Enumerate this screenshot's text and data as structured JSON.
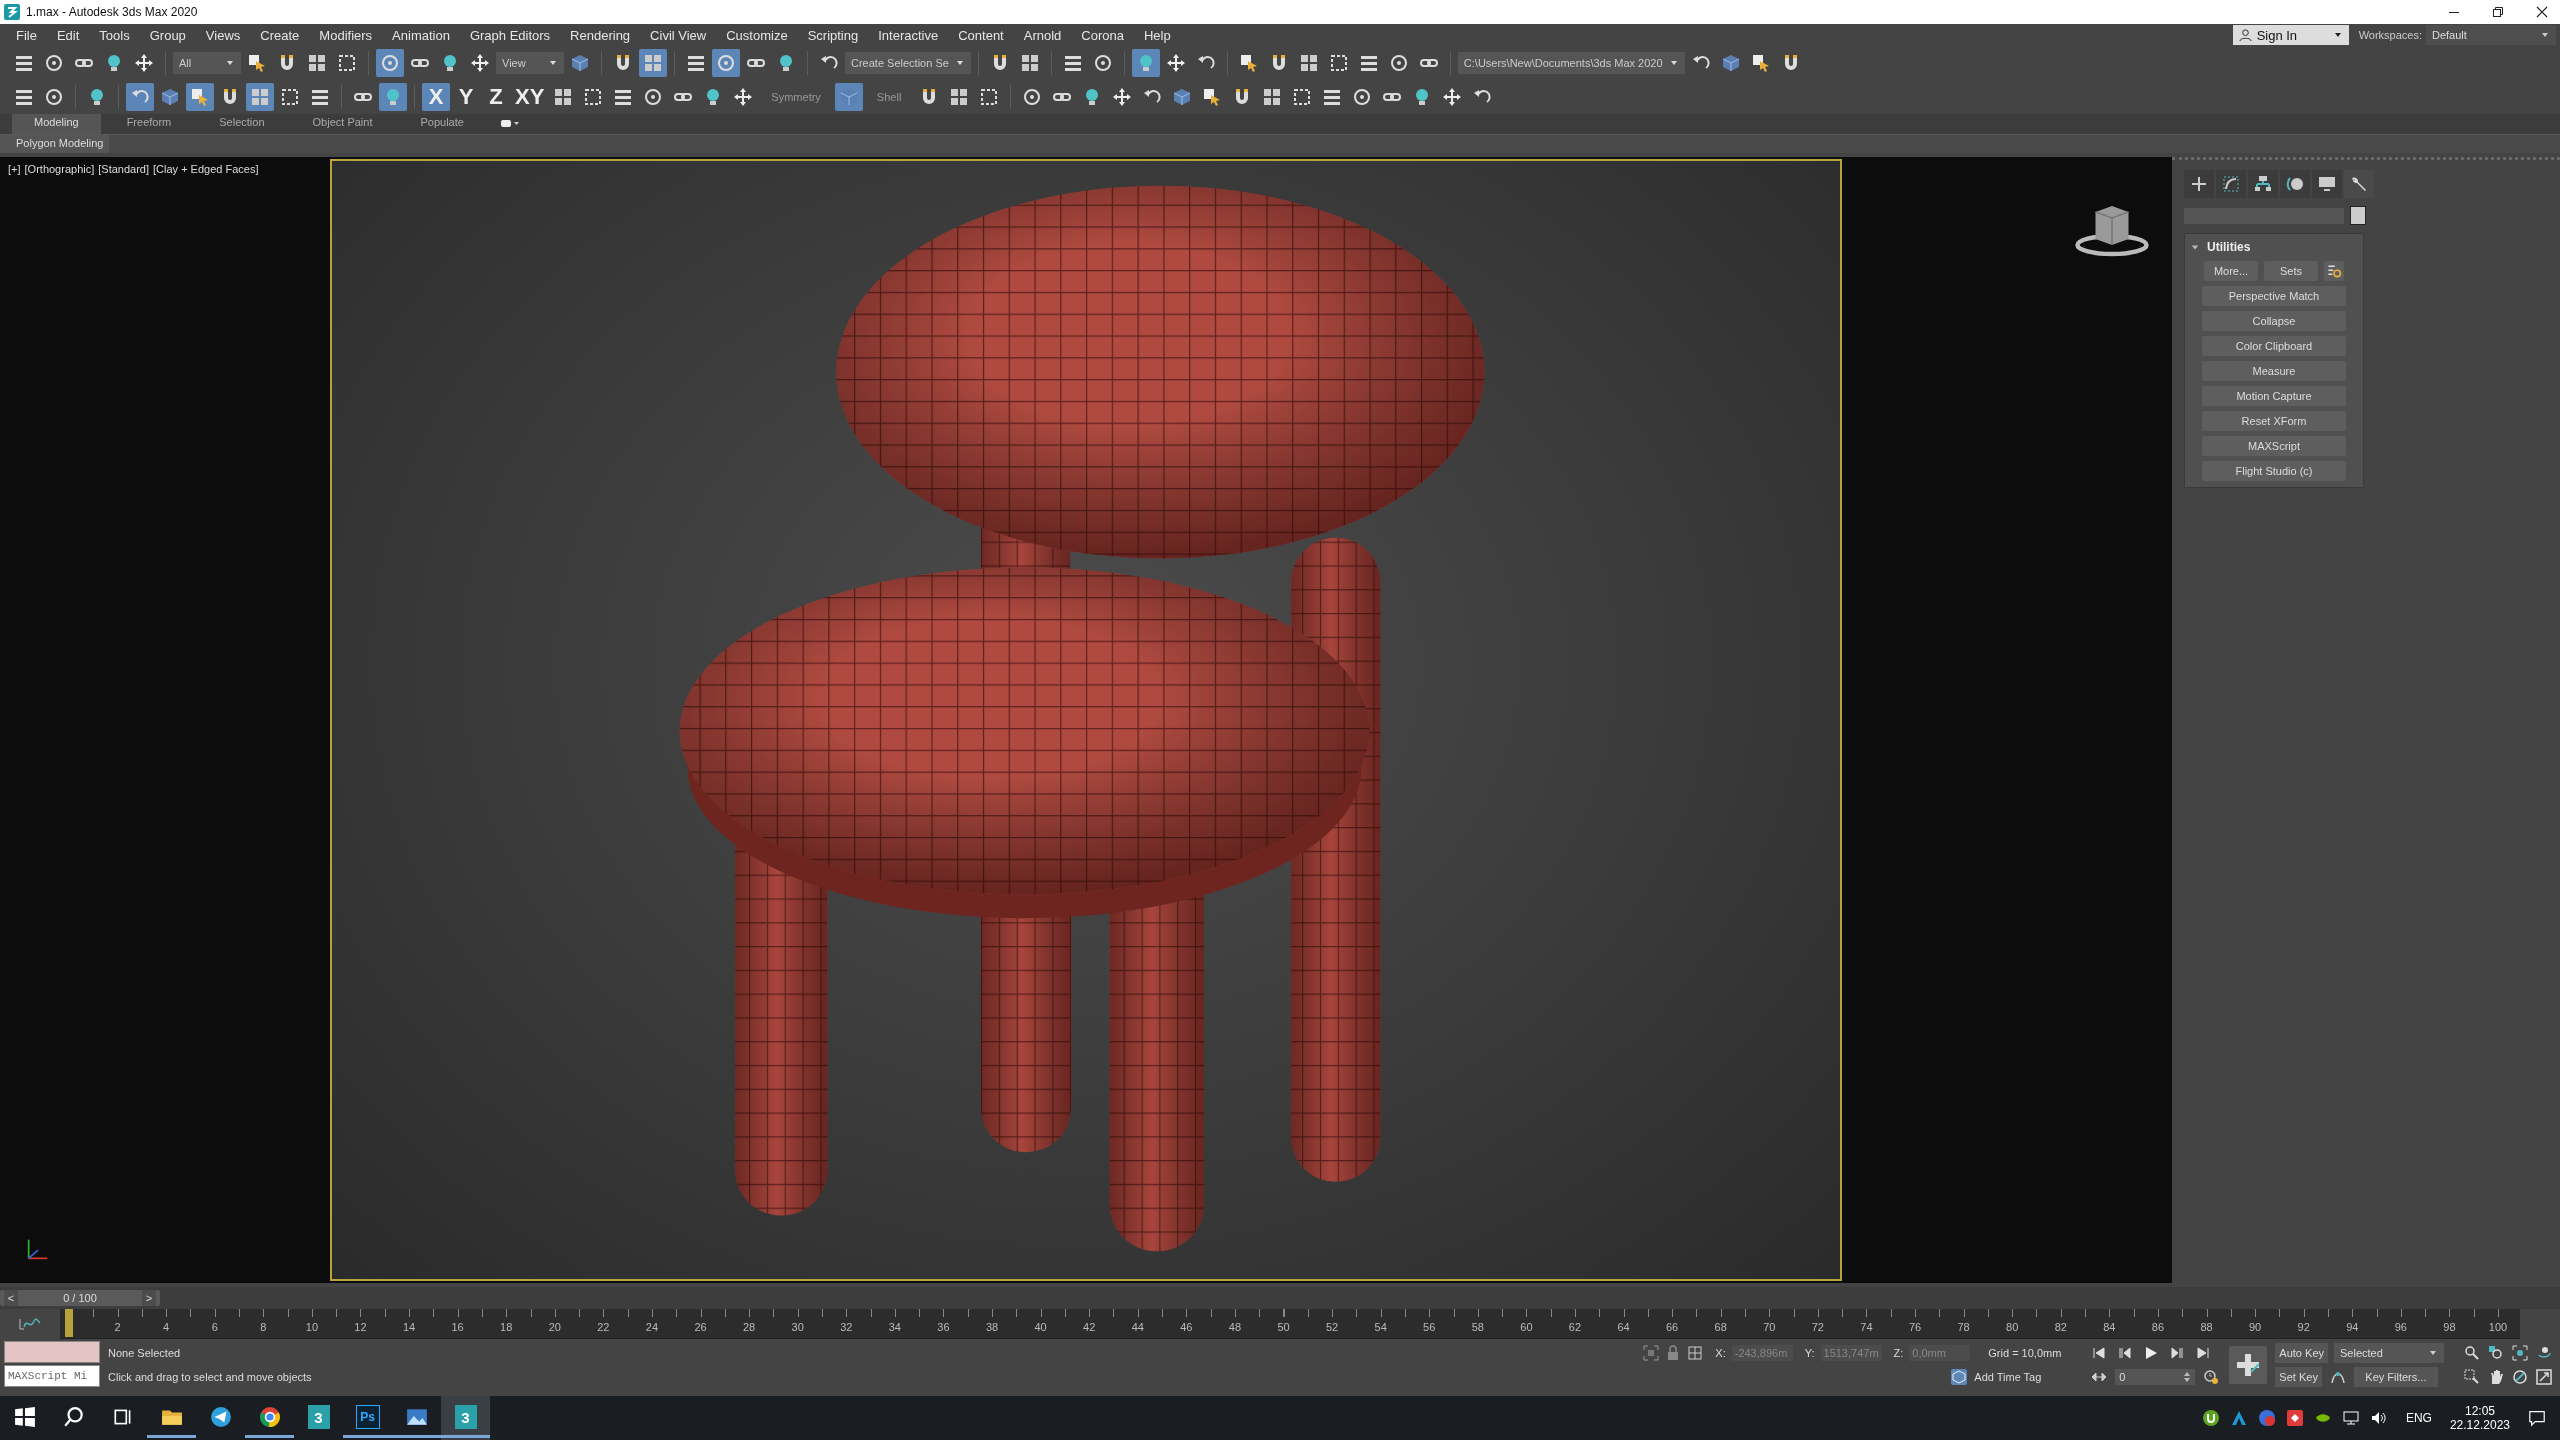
{
  "window": {
    "title": "1.max - Autodesk 3ds Max 2020"
  },
  "menu_bar": [
    "File",
    "Edit",
    "Tools",
    "Group",
    "Views",
    "Create",
    "Modifiers",
    "Animation",
    "Graph Editors",
    "Rendering",
    "Civil View",
    "Customize",
    "Scripting",
    "Interactive",
    "Content",
    "Arnold",
    "Corona",
    "Help"
  ],
  "account": {
    "sign_in": "Sign In",
    "workspaces_label": "Workspaces:",
    "workspace": "Default"
  },
  "toolbar_1": [
    {
      "kind": "icon",
      "selected": false
    },
    {
      "kind": "icon",
      "selected": false
    },
    {
      "kind": "icon",
      "selected": false
    },
    {
      "kind": "icon",
      "selected": false
    },
    {
      "kind": "icon",
      "selected": false
    },
    {
      "kind": "separator"
    },
    {
      "kind": "dropdown",
      "value": "All"
    },
    {
      "kind": "icon",
      "selected": false
    },
    {
      "kind": "icon",
      "selected": false
    },
    {
      "kind": "icon",
      "selected": false
    },
    {
      "kind": "icon",
      "selected": false
    },
    {
      "kind": "separator"
    },
    {
      "kind": "icon",
      "selected": true
    },
    {
      "kind": "icon",
      "selected": false
    },
    {
      "kind": "icon",
      "selected": false
    },
    {
      "kind": "icon",
      "selected": false
    },
    {
      "kind": "dropdown",
      "value": "View"
    },
    {
      "kind": "icon",
      "selected": false
    },
    {
      "kind": "separator"
    },
    {
      "kind": "icon",
      "selected": false
    },
    {
      "kind": "icon",
      "selected": true
    },
    {
      "kind": "separator"
    },
    {
      "kind": "icon",
      "selected": false
    },
    {
      "kind": "icon",
      "selected": true
    },
    {
      "kind": "icon",
      "selected": false
    },
    {
      "kind": "icon",
      "selected": false
    },
    {
      "kind": "separator"
    },
    {
      "kind": "icon",
      "selected": false
    },
    {
      "kind": "dropdown",
      "value": "Create Selection Se"
    },
    {
      "kind": "separator"
    },
    {
      "kind": "icon",
      "selected": false
    },
    {
      "kind": "icon",
      "selected": false
    },
    {
      "kind": "separator"
    },
    {
      "kind": "icon",
      "selected": false
    },
    {
      "kind": "icon",
      "selected": false
    },
    {
      "kind": "separator"
    },
    {
      "kind": "icon",
      "selected": true
    },
    {
      "kind": "icon",
      "selected": false
    },
    {
      "kind": "icon",
      "selected": false
    },
    {
      "kind": "separator"
    },
    {
      "kind": "icon",
      "selected": false
    },
    {
      "kind": "icon",
      "selected": false
    },
    {
      "kind": "icon",
      "selected": false
    },
    {
      "kind": "icon",
      "selected": false
    },
    {
      "kind": "icon",
      "selected": false
    },
    {
      "kind": "icon",
      "selected": false
    },
    {
      "kind": "icon",
      "selected": false
    },
    {
      "kind": "separator"
    },
    {
      "kind": "dropdown",
      "value": "C:\\Users\\New\\Documents\\3ds Max 2020"
    },
    {
      "kind": "icon",
      "selected": false
    },
    {
      "kind": "icon",
      "selected": false
    },
    {
      "kind": "icon",
      "selected": false
    },
    {
      "kind": "icon",
      "selected": false
    }
  ],
  "toolbar_2": [
    {
      "kind": "icon",
      "selected": false
    },
    {
      "kind": "icon",
      "selected": false
    },
    {
      "kind": "separator"
    },
    {
      "kind": "icon",
      "selected": false
    },
    {
      "kind": "separator"
    },
    {
      "kind": "icon",
      "selected": true
    },
    {
      "kind": "icon",
      "selected": false
    },
    {
      "kind": "icon",
      "selected": true
    },
    {
      "kind": "icon",
      "selected": false
    },
    {
      "kind": "icon",
      "selected": true
    },
    {
      "kind": "icon",
      "selected": false
    },
    {
      "kind": "icon",
      "selected": false
    },
    {
      "kind": "separator"
    },
    {
      "kind": "icon",
      "selected": false
    },
    {
      "kind": "icon",
      "selected": true
    },
    {
      "kind": "separator"
    },
    {
      "kind": "letter",
      "label": "X",
      "selected": true
    },
    {
      "kind": "letter",
      "label": "Y",
      "selected": false
    },
    {
      "kind": "letter",
      "label": "Z",
      "selected": false
    },
    {
      "kind": "letter",
      "label": "XY",
      "selected": false
    },
    {
      "kind": "icon",
      "selected": false
    },
    {
      "kind": "icon",
      "selected": false
    },
    {
      "kind": "icon",
      "selected": false
    },
    {
      "kind": "icon",
      "selected": false
    },
    {
      "kind": "icon",
      "selected": false
    },
    {
      "kind": "icon",
      "selected": false
    },
    {
      "kind": "icon",
      "selected": false
    },
    {
      "kind": "label",
      "label": "Symmetry"
    },
    {
      "kind": "icon",
      "selected": true
    },
    {
      "kind": "label",
      "label": "Shell"
    },
    {
      "kind": "icon",
      "selected": false
    },
    {
      "kind": "icon",
      "selected": false
    },
    {
      "kind": "icon",
      "selected": false
    },
    {
      "kind": "separator"
    },
    {
      "kind": "icon",
      "selected": false
    },
    {
      "kind": "icon",
      "selected": false
    },
    {
      "kind": "icon",
      "selected": false
    },
    {
      "kind": "icon",
      "selected": false
    },
    {
      "kind": "icon",
      "selected": false
    },
    {
      "kind": "icon",
      "selected": false
    },
    {
      "kind": "icon",
      "selected": false
    },
    {
      "kind": "icon",
      "selected": false
    },
    {
      "kind": "icon",
      "selected": false
    },
    {
      "kind": "icon",
      "selected": false
    },
    {
      "kind": "icon",
      "selected": false
    },
    {
      "kind": "icon",
      "selected": false
    },
    {
      "kind": "icon",
      "selected": false
    },
    {
      "kind": "icon",
      "selected": false
    },
    {
      "kind": "icon",
      "selected": false
    },
    {
      "kind": "icon",
      "selected": false
    }
  ],
  "ribbon": {
    "tabs": [
      {
        "label": "Modeling",
        "selected": true
      },
      {
        "label": "Freeform",
        "selected": false
      },
      {
        "label": "Selection",
        "selected": false
      },
      {
        "label": "Object Paint",
        "selected": false
      },
      {
        "label": "Populate",
        "selected": false
      }
    ],
    "panel": "Polygon Modeling"
  },
  "viewport": {
    "labels": [
      "[+]",
      "[Orthographic]",
      "[Standard]",
      "[Clay + Edged Faces]"
    ],
    "active": true
  },
  "command_panel": {
    "tabs": [
      {
        "selected": false
      },
      {
        "selected": false
      },
      {
        "selected": false
      },
      {
        "selected": false
      },
      {
        "selected": false
      },
      {
        "selected": true
      }
    ],
    "rollout": {
      "title": "Utilities",
      "expanded": true,
      "top_buttons": [
        "More...",
        "Sets"
      ],
      "buttons": [
        "Perspective Match",
        "Collapse",
        "Color Clipboard",
        "Measure",
        "Motion Capture",
        "Reset XForm",
        "MAXScript",
        "Flight Studio (c)"
      ]
    }
  },
  "time_slider": {
    "prev": "<",
    "position": "0 / 100",
    "next": ">",
    "level": 0
  },
  "track_bar": {
    "labels": [
      "2",
      "4",
      "6",
      "8",
      "10",
      "12",
      "14",
      "16",
      "18",
      "20",
      "22",
      "24",
      "26",
      "28",
      "30",
      "32",
      "34",
      "36",
      "38",
      "40",
      "42",
      "44",
      "46",
      "48",
      "50",
      "52",
      "54",
      "56",
      "58",
      "60",
      "62",
      "64",
      "66",
      "68",
      "70",
      "72",
      "74",
      "76",
      "78",
      "80",
      "82",
      "84",
      "86",
      "88",
      "90",
      "92",
      "94",
      "96",
      "98",
      "100"
    ]
  },
  "status": {
    "selection": "None Selected",
    "prompt": "Click and drag to select and move objects",
    "maxscript": "MAXScript Mi",
    "x_label": "X:",
    "x": "-243,896m",
    "y_label": "Y:",
    "y": "1513,747m",
    "z_label": "Z:",
    "z": "0,0mm",
    "grid": "Grid = 10,0mm",
    "add_time_tag": "Add Time Tag"
  },
  "animation": {
    "frame": "0",
    "auto_key": "Auto Key",
    "set_key": "Set Key",
    "key_set": "Selected",
    "key_filters": "Key Filters..."
  },
  "taskbar": {
    "apps": [
      {
        "kind": "start",
        "running": false
      },
      {
        "kind": "search",
        "running": false
      },
      {
        "kind": "task-view",
        "running": false
      },
      {
        "kind": "folder",
        "running": true
      },
      {
        "kind": "telegram",
        "running": false
      },
      {
        "kind": "chrome",
        "running": true
      },
      {
        "kind": "max",
        "label": "3",
        "running": false
      },
      {
        "kind": "photoshop",
        "label": "Ps",
        "running": true
      },
      {
        "kind": "photos",
        "running": true
      },
      {
        "kind": "max",
        "label": "3",
        "running": true,
        "selected": true
      }
    ],
    "language": "ENG",
    "time": "12:05",
    "date": "22.12.2023"
  }
}
